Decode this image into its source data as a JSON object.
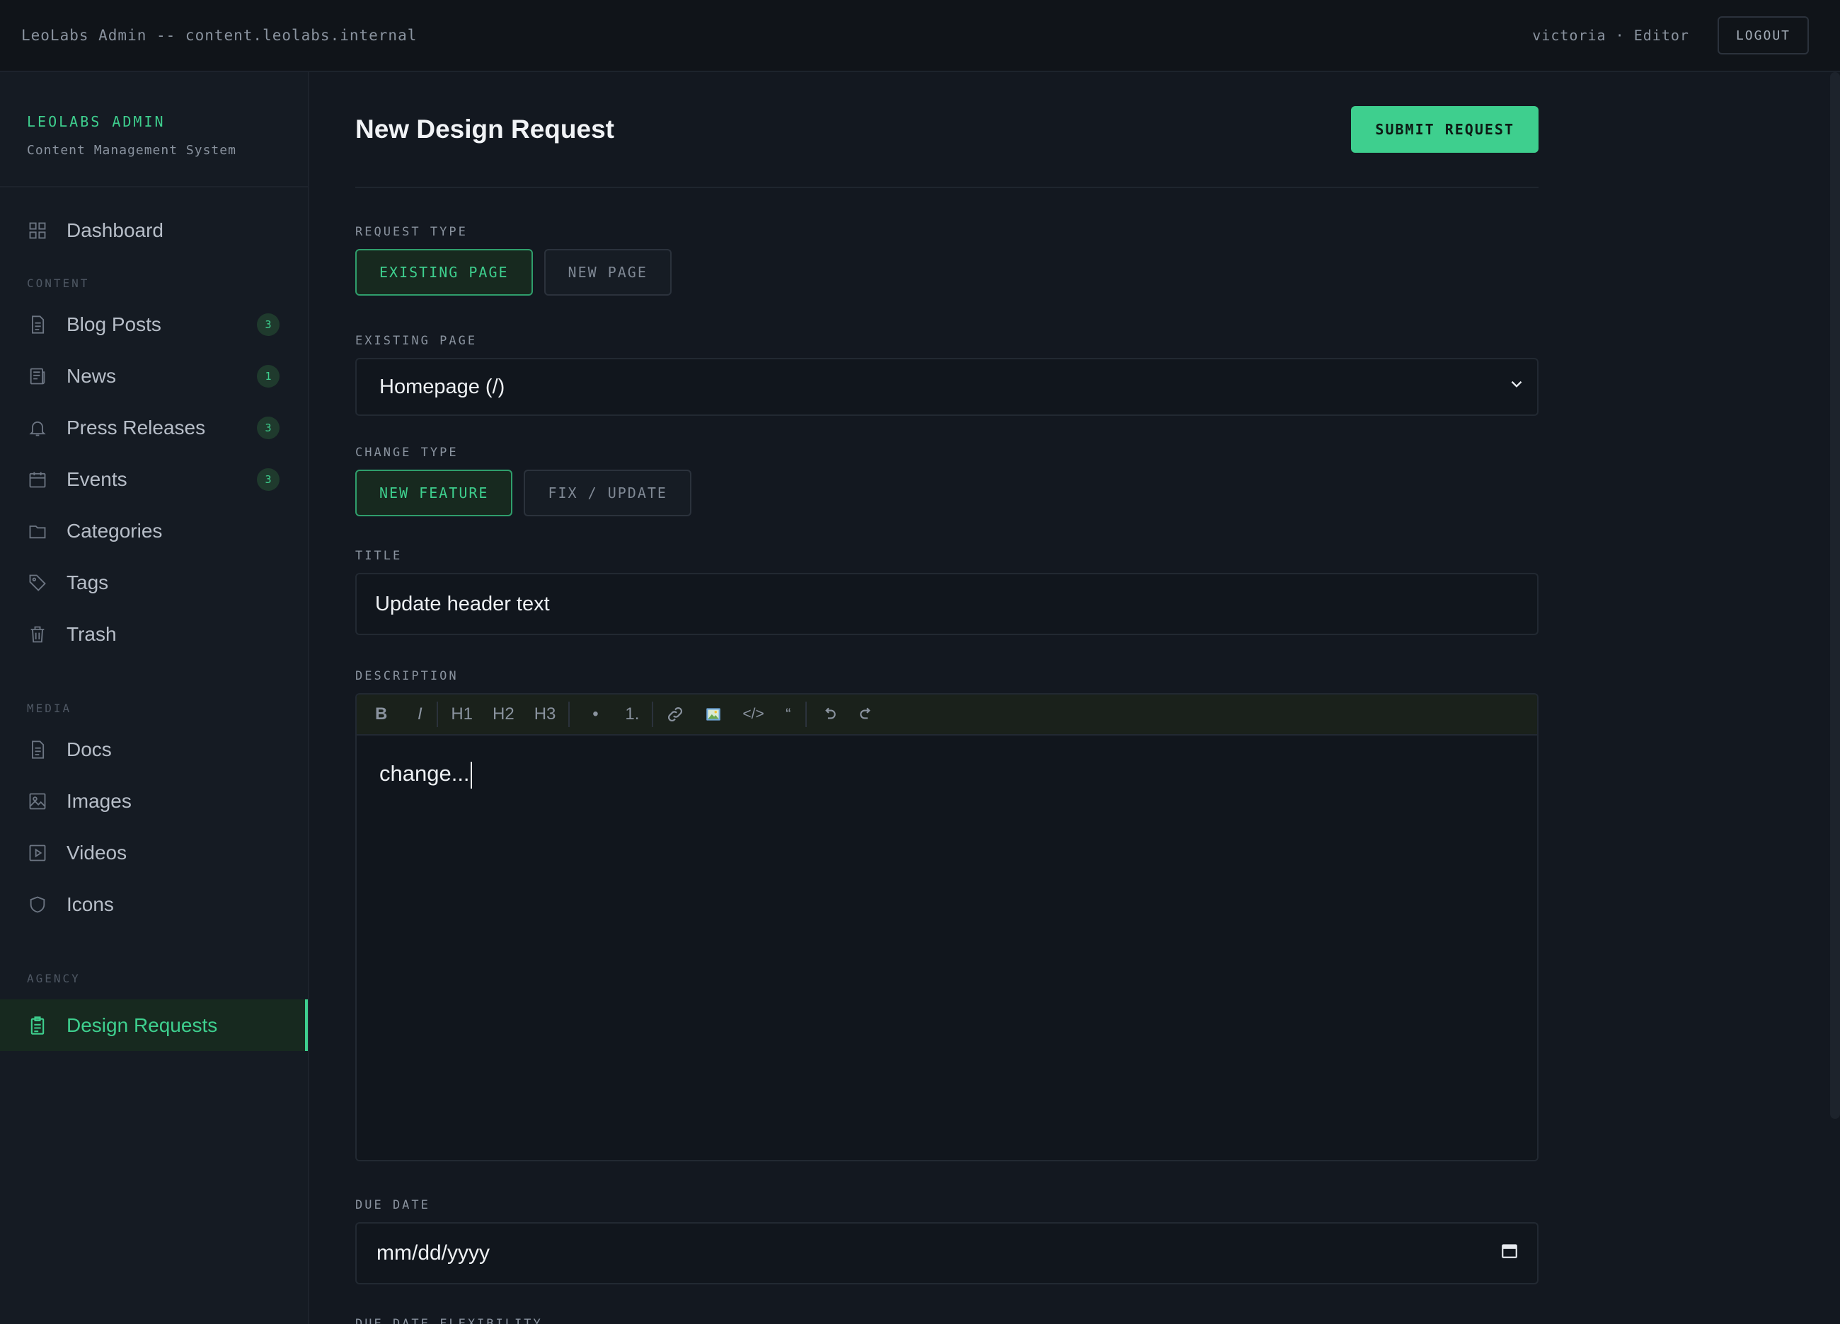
{
  "topbar": {
    "host": "LeoLabs Admin -- content.leolabs.internal",
    "user": "victoria · Editor",
    "logout": "LOGOUT"
  },
  "sidebar": {
    "brand_name": "LEOLABS ADMIN",
    "brand_sub": "Content Management System",
    "dashboard": "Dashboard",
    "sections": {
      "content": "CONTENT",
      "media": "MEDIA",
      "agency": "AGENCY"
    },
    "content_items": [
      {
        "label": "Blog Posts",
        "badge": "3",
        "icon": "document-icon"
      },
      {
        "label": "News",
        "badge": "1",
        "icon": "newspaper-icon"
      },
      {
        "label": "Press Releases",
        "badge": "3",
        "icon": "bell-icon"
      },
      {
        "label": "Events",
        "badge": "3",
        "icon": "calendar-icon"
      },
      {
        "label": "Categories",
        "badge": "",
        "icon": "folder-icon"
      },
      {
        "label": "Tags",
        "badge": "",
        "icon": "tag-icon"
      },
      {
        "label": "Trash",
        "badge": "",
        "icon": "trash-icon"
      }
    ],
    "media_items": [
      {
        "label": "Docs",
        "icon": "document-icon"
      },
      {
        "label": "Images",
        "icon": "image-icon"
      },
      {
        "label": "Videos",
        "icon": "video-icon"
      },
      {
        "label": "Icons",
        "icon": "shield-icon"
      }
    ],
    "agency_items": [
      {
        "label": "Design Requests",
        "icon": "clipboard-icon",
        "active": true
      }
    ]
  },
  "main": {
    "title": "New Design Request",
    "submit": "SUBMIT REQUEST",
    "request_type": {
      "label": "REQUEST TYPE",
      "options": [
        "EXISTING PAGE",
        "NEW PAGE"
      ],
      "selected": "EXISTING PAGE"
    },
    "existing_page": {
      "label": "EXISTING PAGE",
      "value": "Homepage (/)"
    },
    "change_type": {
      "label": "CHANGE TYPE",
      "options": [
        "NEW FEATURE",
        "FIX / UPDATE"
      ],
      "selected": "NEW FEATURE"
    },
    "title_field": {
      "label": "TITLE",
      "value": "Update header text"
    },
    "description": {
      "label": "DESCRIPTION",
      "toolbar": [
        "B",
        "I",
        "H1",
        "H2",
        "H3",
        "•",
        "1."
      ],
      "value": "change..."
    },
    "due_date": {
      "label": "DUE DATE",
      "placeholder": "mm/dd/yyyy"
    },
    "due_date_flex": {
      "label": "DUE DATE FLEXIBILITY"
    }
  },
  "colors": {
    "accent": "#3ecf8e",
    "background": "#131820",
    "sidebar": "#151b23"
  }
}
